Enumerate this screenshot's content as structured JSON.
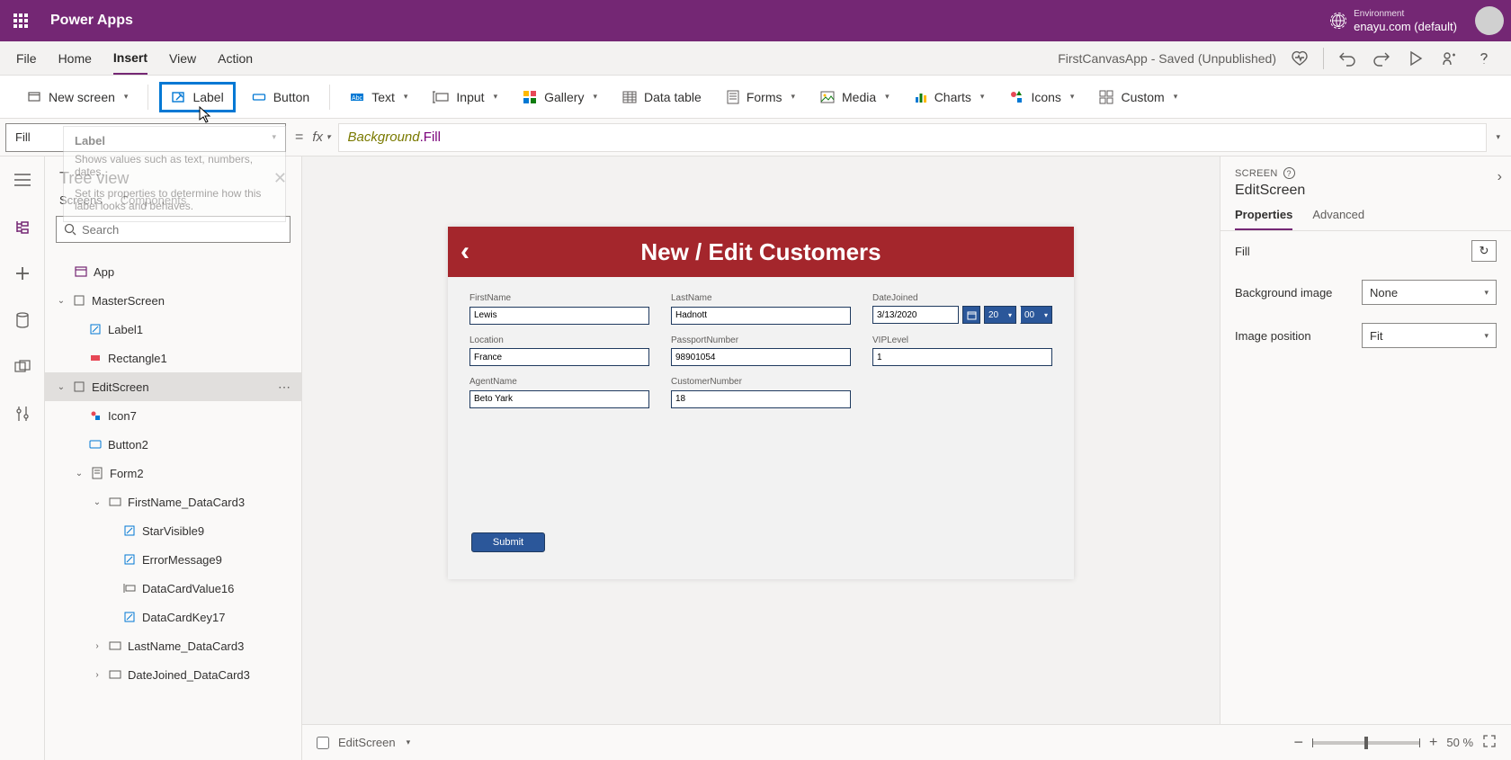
{
  "header": {
    "app_name": "Power Apps",
    "env_label": "Environment",
    "env_value": "enayu.com (default)"
  },
  "menu": {
    "items": [
      "File",
      "Home",
      "Insert",
      "View",
      "Action"
    ],
    "active_index": 2,
    "app_status": "FirstCanvasApp - Saved (Unpublished)"
  },
  "ribbon": {
    "new_screen": "New screen",
    "label": "Label",
    "button": "Button",
    "text": "Text",
    "input": "Input",
    "gallery": "Gallery",
    "data_table": "Data table",
    "forms": "Forms",
    "media": "Media",
    "charts": "Charts",
    "icons": "Icons",
    "custom": "Custom"
  },
  "tooltip": {
    "title": "Label",
    "line1": "Shows values such as text, numbers, dates.",
    "line2": "Set its properties to determine how this label looks and behaves."
  },
  "formula": {
    "property": "Fill",
    "token1": "Background",
    "token2": ".Fill"
  },
  "tree": {
    "title": "Tree view",
    "tab_screens": "Screens",
    "tab_components": "Components",
    "search_placeholder": "Search",
    "nodes": {
      "app": "App",
      "master": "MasterScreen",
      "label1": "Label1",
      "rect1": "Rectangle1",
      "edit": "EditScreen",
      "icon7": "Icon7",
      "button2": "Button2",
      "form2": "Form2",
      "fn_dc": "FirstName_DataCard3",
      "star9": "StarVisible9",
      "err9": "ErrorMessage9",
      "dcv16": "DataCardValue16",
      "dck17": "DataCardKey17",
      "ln_dc": "LastName_DataCard3",
      "dj_dc": "DateJoined_DataCard3"
    }
  },
  "canvas": {
    "title": "New / Edit Customers",
    "fields": {
      "fn_label": "FirstName",
      "fn_value": "Lewis",
      "ln_label": "LastName",
      "ln_value": "Hadnott",
      "dj_label": "DateJoined",
      "dj_value": "3/13/2020",
      "dj_h": "20",
      "dj_m": "00",
      "loc_label": "Location",
      "loc_value": "France",
      "pp_label": "PassportNumber",
      "pp_value": "98901054",
      "vip_label": "VIPLevel",
      "vip_value": "1",
      "ag_label": "AgentName",
      "ag_value": "Beto Yark",
      "cn_label": "CustomerNumber",
      "cn_value": "18"
    },
    "submit": "Submit"
  },
  "props": {
    "section": "SCREEN",
    "object": "EditScreen",
    "tab_properties": "Properties",
    "tab_advanced": "Advanced",
    "fill_label": "Fill",
    "bg_label": "Background image",
    "bg_value": "None",
    "imgpos_label": "Image position",
    "imgpos_value": "Fit"
  },
  "status": {
    "breadcrumb": "EditScreen",
    "zoom": "50",
    "zoom_suffix": "%"
  }
}
